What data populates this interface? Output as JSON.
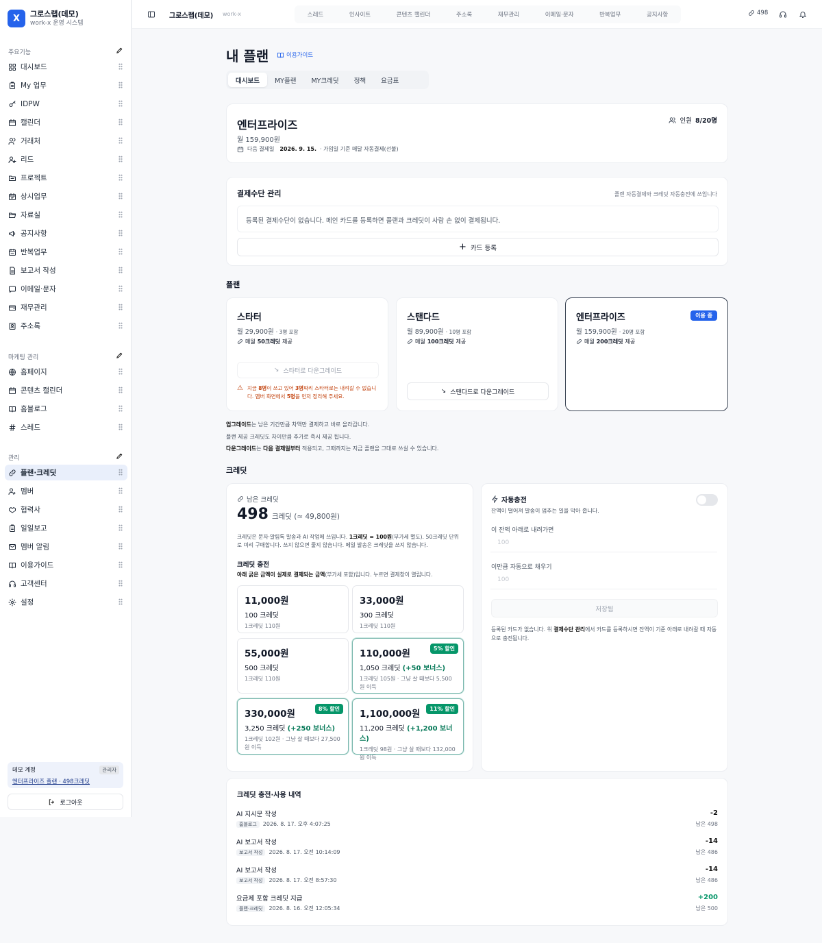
{
  "brand": {
    "logo": "X",
    "name": "그로스랩(데모)",
    "sub": "work-x 운영 시스템"
  },
  "sidebar": {
    "sections": [
      {
        "title": "주요기능",
        "items": [
          "대시보드",
          "My 업무",
          "IDPW",
          "캘린더",
          "거래처",
          "리드",
          "프로젝트",
          "상시업무",
          "자료실",
          "공지사항",
          "반복업무",
          "보고서 작성",
          "이메일·문자",
          "재무관리",
          "주소록"
        ]
      },
      {
        "title": "마케팅 관리",
        "items": [
          "홈페이지",
          "콘텐츠 캘린더",
          "홈블로그",
          "스레드"
        ]
      },
      {
        "title": "관리",
        "items": [
          "플랜·크레딧",
          "멤버",
          "협력사",
          "일일보고",
          "멤버 알림",
          "이용가이드",
          "고객센터",
          "설정"
        ]
      }
    ],
    "icons": {
      "대시보드": "grid-icon",
      "My 업무": "clipboard-icon",
      "IDPW": "key-icon",
      "캘린더": "calendar-icon",
      "거래처": "users-icon",
      "리드": "user-plus-icon",
      "프로젝트": "folder-icon",
      "상시업무": "calendar-check-icon",
      "자료실": "folder-open-icon",
      "공지사항": "megaphone-icon",
      "반복업무": "calendar-repeat-icon",
      "보고서 작성": "document-icon",
      "이메일·문자": "message-icon",
      "재무관리": "wallet-icon",
      "주소록": "contact-icon",
      "홈페이지": "globe-icon",
      "콘텐츠 캘린더": "calendar-icon",
      "홈블로그": "book-icon",
      "스레드": "hash-icon",
      "플랜·크레딧": "link-icon",
      "멤버": "user-icon",
      "협력사": "handshake-icon",
      "일일보고": "clipboard-icon",
      "멤버 알림": "mail-icon",
      "이용가이드": "book-icon",
      "고객센터": "headset-icon",
      "설정": "gear-icon"
    },
    "active": "플랜·크레딧",
    "account": {
      "title": "데모 계정",
      "role": "관리자",
      "plan": "엔터프라이즈 플랜 · 498크레딧"
    },
    "logout": "로그아웃"
  },
  "topbar": {
    "workspace": "그로스랩(데모)",
    "sub": "work-x",
    "nav": [
      "스레드",
      "인사이트",
      "콘텐츠 캘린더",
      "주소록",
      "재무관리",
      "이메일·문자",
      "반복업무",
      "공지사항"
    ],
    "credits": "498"
  },
  "page": {
    "title": "내 플랜",
    "guide": "이용가이드",
    "tabs": [
      "대시보드",
      "MY플랜",
      "MY크레딧",
      "정책",
      "요금표"
    ],
    "active_tab": "대시보드"
  },
  "current_plan": {
    "name": "엔터프라이즈",
    "price": "월 159,900원",
    "next_label": "다음 결제일",
    "next_date": "2026. 9. 15.",
    "next_note": "· 가입일 기준 매달 자동결제(선불)",
    "seats_label": "인원",
    "seats": "8/20명"
  },
  "payment": {
    "title": "결제수단 관리",
    "note": "플랜 자동결제와 크레딧 자동충전에 쓰입니다",
    "empty": "등록된 결제수단이 없습니다. 메인 카드를 등록하면 플랜과 크레딧이 사람 손 없이 결제됩니다.",
    "add": "카드 등록"
  },
  "plans": {
    "title": "플랜",
    "items": [
      {
        "name": "스타터",
        "price": "월 29,900원",
        "seats": "· 3명 포함",
        "credit_pre": "매월 ",
        "credit": "50크레딧",
        "credit_post": " 제공",
        "button": "스타터로 다운그레이드",
        "disabled": true
      },
      {
        "name": "스탠다드",
        "price": "월 89,900원",
        "seats": "· 10명 포함",
        "credit_pre": "매월 ",
        "credit": "100크레딧",
        "credit_post": " 제공",
        "button": "스탠다드로 다운그레이드",
        "disabled": false
      },
      {
        "name": "엔터프라이즈",
        "price": "월 159,900원",
        "seats": "· 20명 포함",
        "credit_pre": "매월 ",
        "credit": "200크레딧",
        "credit_post": " 제공",
        "badge": "이용 중"
      }
    ],
    "warning": {
      "p1": "지금 ",
      "n1": "8명",
      "p2": "이 쓰고 있어 ",
      "n2": "3명",
      "p3": "짜리 스타터로는 내려갈 수 없습니다. 멤버 화면에서 ",
      "n3": "5명",
      "p4": "을 먼저 정리해 주세요."
    },
    "notes": [
      {
        "b": "업그레이드",
        "t": "는 남은 기간만큼 차액만 결제하고 바로 올라갑니다."
      },
      {
        "b": "",
        "t": "플랜 제공 크레딧도 차이만큼 추가로 즉시 제공 됩니다."
      },
      {
        "b": "다운그레이드",
        "t": "는 ",
        "b2": "다음 결제일부터",
        "t2": " 적용되고, 그때까지는 지금 플랜을 그대로 쓰실 수 있습니다."
      }
    ]
  },
  "credits": {
    "title": "크레딧",
    "remaining_label": "남은 크레딧",
    "remaining": "498",
    "remaining_unit": "크레딧 (≈ 49,800원)",
    "desc_1": "크레딧은 문자·알림톡 발송과 AI 작업에 쓰입니다. ",
    "desc_b": "1크레딧 = 100원",
    "desc_2": "(부가세 별도). 50크레딧 단위로 미리 구매합니다. 쓰지 않으면 줄지 않습니다. 메일 발송은 크레딧을 쓰지 않습니다.",
    "charge_title": "크레딧 충전",
    "charge_desc_b": "아래 굵은 금액이 실제로 결제되는 금액",
    "charge_desc": "(부가세 포함)입니다. 누르면 결제창이 열립니다.",
    "packages": [
      {
        "price": "11,000원",
        "credits": "100 크레딧",
        "bonus": "",
        "unit": "1크레딧 110원",
        "discount": ""
      },
      {
        "price": "33,000원",
        "credits": "300 크레딧",
        "bonus": "",
        "unit": "1크레딧 110원",
        "discount": ""
      },
      {
        "price": "55,000원",
        "credits": "500 크레딧",
        "bonus": "",
        "unit": "1크레딧 110원",
        "discount": ""
      },
      {
        "price": "110,000원",
        "credits": "1,050 크레딧",
        "bonus": "(+50 보너스)",
        "unit": "1크레딧 105원 · 그냥 살 때보다 5,500원 이득",
        "discount": "5% 할인"
      },
      {
        "price": "330,000원",
        "credits": "3,250 크레딧",
        "bonus": "(+250 보너스)",
        "unit": "1크레딧 102원 · 그냥 살 때보다 27,500원 이득",
        "discount": "8% 할인"
      },
      {
        "price": "1,100,000원",
        "credits": "11,200 크레딧",
        "bonus": "(+1,200 보너스)",
        "unit": "1크레딧 98원 · 그냥 살 때보다 132,000원 이득",
        "discount": "11% 할인"
      }
    ]
  },
  "autocharge": {
    "title": "자동충전",
    "desc": "잔액이 떨어져 발송이 멈추는 일을 막아 줍니다.",
    "enabled": false,
    "threshold_label": "이 잔액 아래로 내려가면",
    "threshold_placeholder": "100",
    "amount_label": "이만큼 자동으로 채우기",
    "amount_placeholder": "100",
    "save": "저장됨",
    "note_1": "등록된 카드가 없습니다. 위 ",
    "note_b": "결제수단 관리",
    "note_2": "에서 카드를 등록하시면 잔액이 기준 아래로 내려갈 때 자동으로 충전됩니다."
  },
  "history": {
    "title": "크레딧 충전·사용 내역",
    "rows": [
      {
        "title": "AI 지시문 작성",
        "tag": "홈블로그",
        "time": "2026. 8. 17. 오후 4:07:25",
        "delta": "-2",
        "balance": "남은 498",
        "positive": false
      },
      {
        "title": "AI 보고서 작성",
        "tag": "보고서 작성",
        "time": "2026. 8. 17. 오전 10:14:09",
        "delta": "-14",
        "balance": "남은 486",
        "positive": false
      },
      {
        "title": "AI 보고서 작성",
        "tag": "보고서 작성",
        "time": "2026. 8. 17. 오전 8:57:30",
        "delta": "-14",
        "balance": "남은 486",
        "positive": false
      },
      {
        "title": "요금제 포함 크레딧 지급",
        "tag": "플랜·크레딧",
        "time": "2026. 8. 16. 오전 12:05:34",
        "delta": "+200",
        "balance": "남은 500",
        "positive": true
      }
    ]
  },
  "colors": {
    "accent": "#2563eb",
    "positive": "#059669",
    "warning": "#c2410c"
  }
}
